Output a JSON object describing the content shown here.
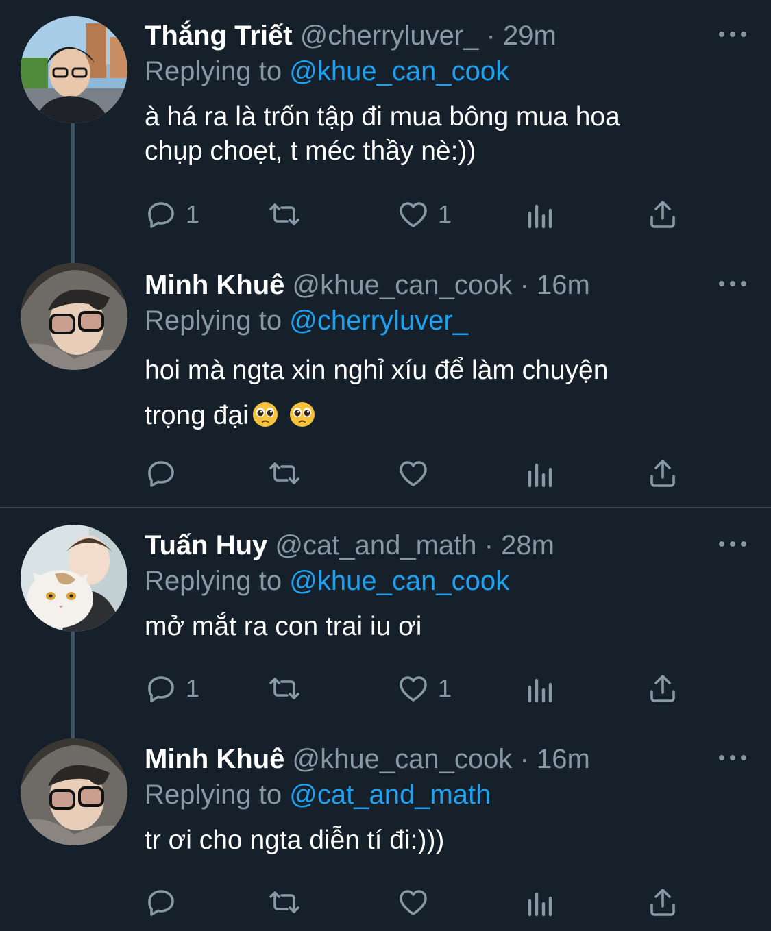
{
  "tweets": [
    {
      "name": "Thắng Triết",
      "handle": "@cherryluver_",
      "time": "29m",
      "replying_label": "Replying to",
      "replying_to": "@khue_can_cook",
      "text_lines": [
        "à há ra là trốn tập đi mua bông mua hoa",
        "chụp choẹt, t méc thầy nè:))"
      ],
      "reply_count": "1",
      "like_count": "1"
    },
    {
      "name": "Minh Khuê",
      "handle": "@khue_can_cook",
      "time": "16m",
      "replying_label": "Replying to",
      "replying_to": "@cherryluver_",
      "text_lines": [
        "hoi mà ngta xin nghỉ xíu để làm chuyện",
        "trọng đại"
      ],
      "emoji": "pleading-face-emoji",
      "reply_count": "",
      "like_count": ""
    },
    {
      "name": "Tuấn Huy",
      "handle": "@cat_and_math",
      "time": "28m",
      "replying_label": "Replying to",
      "replying_to": "@khue_can_cook",
      "text_lines": [
        "mở mắt ra con trai iu ơi"
      ],
      "reply_count": "1",
      "like_count": "1"
    },
    {
      "name": "Minh Khuê",
      "handle": "@khue_can_cook",
      "time": "16m",
      "replying_label": "Replying to",
      "replying_to": "@cat_and_math",
      "text_lines": [
        "tr ơi cho ngta diễn tí đi:)))"
      ],
      "reply_count": "",
      "like_count": ""
    }
  ],
  "separator": "·",
  "colors": {
    "background": "#15202b",
    "secondary_text": "#8899a6",
    "link": "#1da1f2",
    "thread_line": "#3d5466"
  },
  "icons": [
    "reply-icon",
    "retweet-icon",
    "like-icon",
    "analytics-icon",
    "share-icon",
    "more-icon"
  ]
}
